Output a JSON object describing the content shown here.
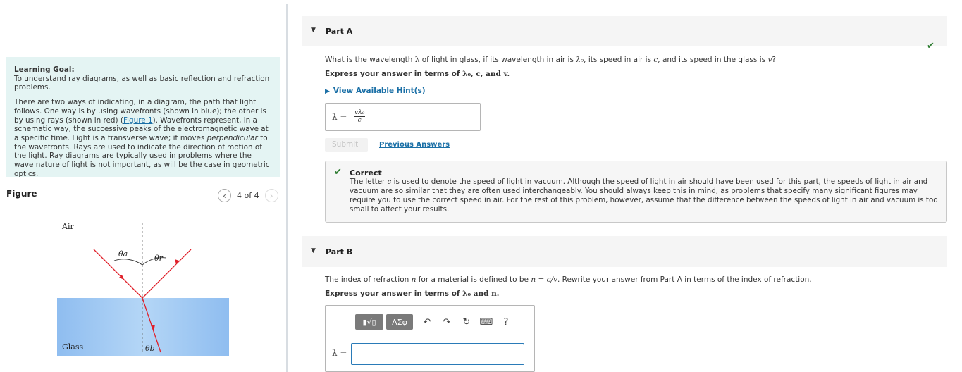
{
  "left": {
    "learning_goal_title": "Learning Goal:",
    "learning_goal_text": "To understand ray diagrams, as well as basic reflection and refraction problems.",
    "intro_part1": "There are two ways of indicating, in a diagram, the path that light follows. One way is by using wavefronts (shown in blue); the other is by using rays (shown in red) (",
    "figure_link": "Figure 1",
    "intro_part2": "). Wavefronts represent, in a schematic way, the successive peaks of the electromagnetic wave at a specific time. Light is a transverse wave; it moves ",
    "intro_emph": "perpendicular",
    "intro_part3": " to the wavefronts. Rays are used to indicate the direction of motion of the light. Ray diagrams are typically used in problems where the wave nature of light is not important, as will be the case in geometric optics.",
    "figure_label": "Figure",
    "pager": "4 of 4",
    "figure": {
      "air_label": "Air",
      "glass_label": "Glass",
      "theta_a": "θa",
      "theta_r": "θr",
      "theta_b": "θb"
    }
  },
  "partA": {
    "title": "Part A",
    "question_pre": "What is the wavelength ",
    "question_lam": "λ",
    "question_mid1": " of light in glass, if its wavelength in air is ",
    "question_lam0": "λ₀",
    "question_mid2": ", its speed in air is ",
    "question_c": "c",
    "question_mid3": ", and its speed in the glass is ",
    "question_v": "v",
    "question_end": "?",
    "instruction_pre": "Express your answer in terms of ",
    "instruction_vars": "λ₀, c, and v.",
    "hint_label": "View Available Hint(s)",
    "answer_lhs": "λ =",
    "answer_num": "vλ₀",
    "answer_den": "c",
    "submit_label": "Submit",
    "previous_label": "Previous Answers",
    "correct_title": "Correct",
    "correct_text_pre": "The letter ",
    "correct_c": "c",
    "correct_text_post": " is used to denote the speed of light in vacuum. Although the speed of light in air should have been used for this part, the speeds of light in air and vacuum are so similar that they are often used interchangeably. You should always keep this in mind, as problems that specify many significant figures may require you to use the correct speed in air. For the rest of this problem, however, assume that the difference between the speeds of light in air and vacuum is too small to affect your results."
  },
  "partB": {
    "title": "Part B",
    "question_pre": "The index of refraction ",
    "question_n": "n",
    "question_mid": " for a material is defined to be ",
    "question_formula": "n = c/v",
    "question_end": ". Rewrite your answer from Part A in terms of the index of refraction.",
    "instruction_pre": "Express your answer in terms of ",
    "instruction_vars": "λ₀ and n.",
    "toolbar": {
      "templates": "▮√▯",
      "greek": "ΑΣφ",
      "undo": "↶",
      "redo": "↷",
      "reset": "↻",
      "keyboard": "⌨",
      "help": "?"
    },
    "answer_lhs": "λ =",
    "answer_value": ""
  },
  "colors": {
    "link": "#1a6fa6",
    "correct": "#2f7d32",
    "goal_bg": "#e4f4f3",
    "ray": "#e0202a",
    "glass": "#a8cdf2"
  }
}
